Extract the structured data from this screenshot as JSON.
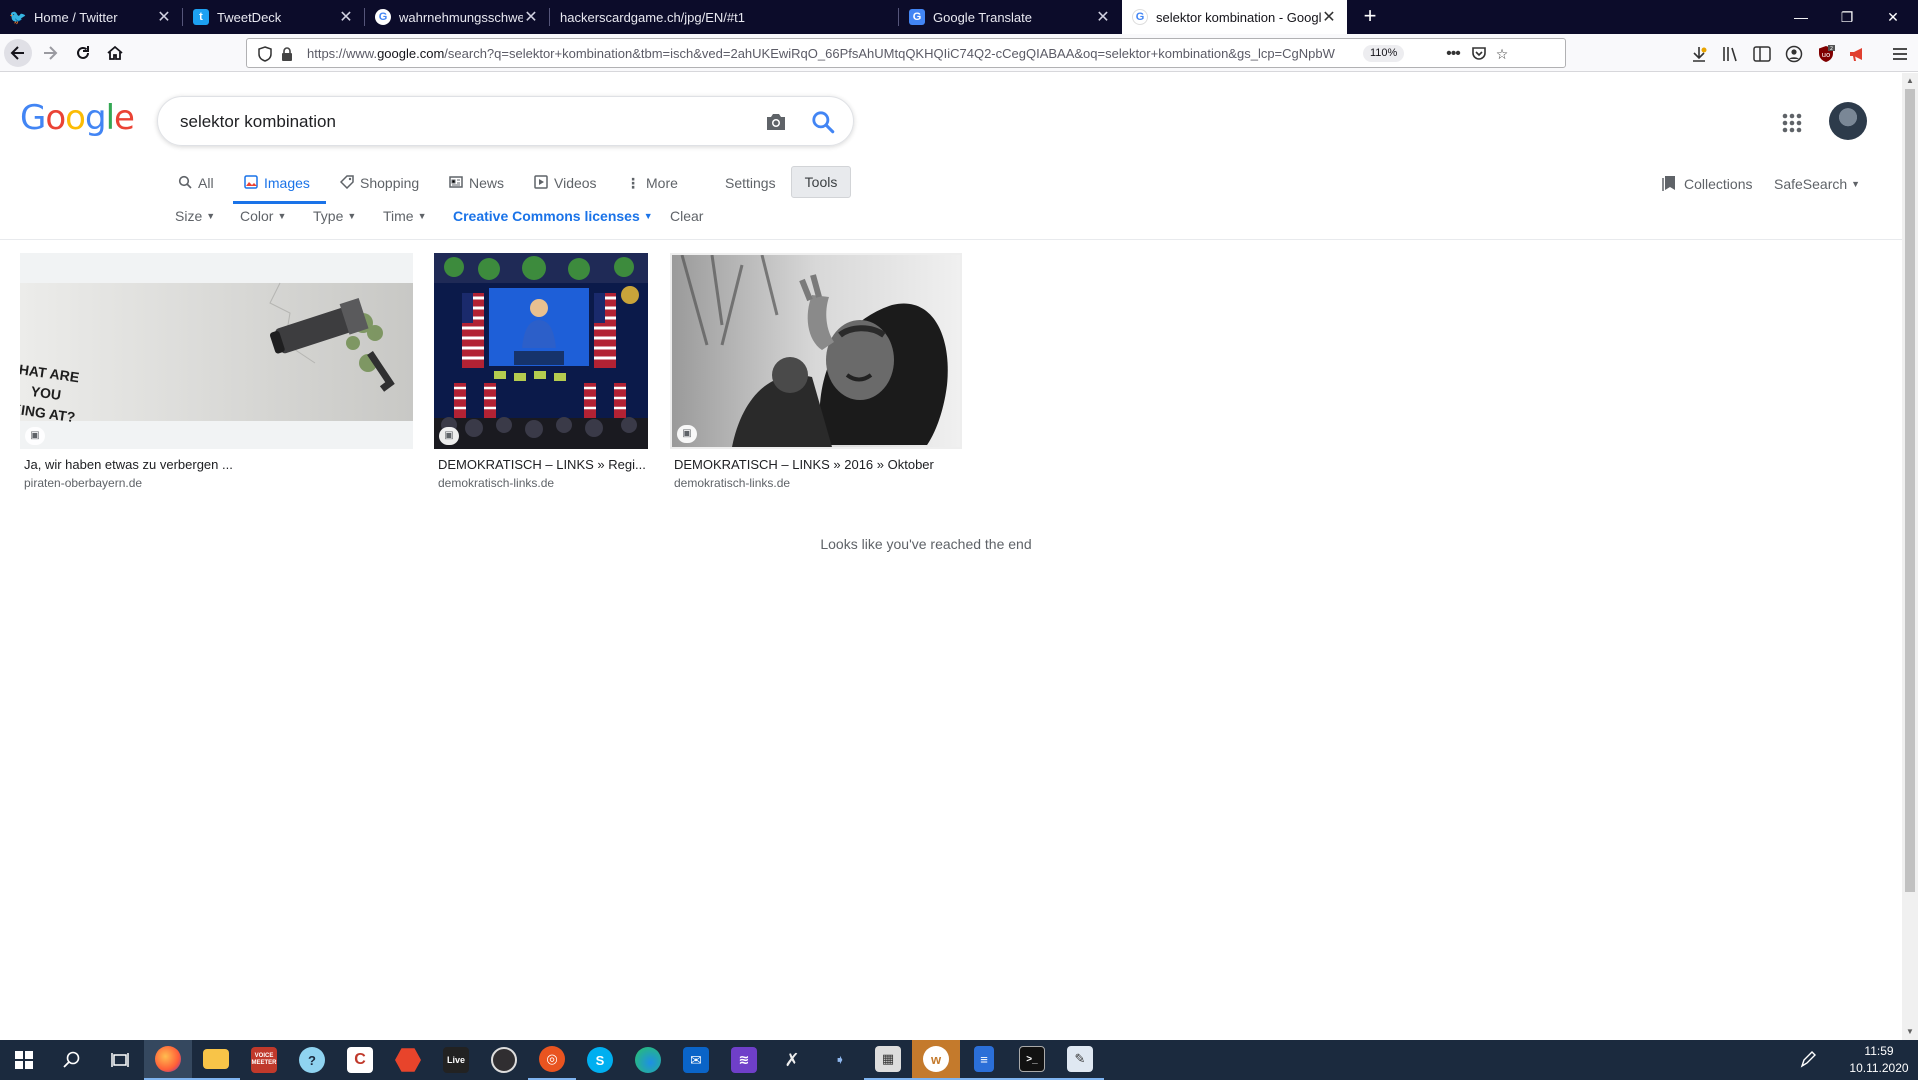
{
  "browser": {
    "tabs": [
      {
        "title": "Home / Twitter",
        "icon": "twitter-icon"
      },
      {
        "title": "TweetDeck",
        "icon": "tweetdeck-icon"
      },
      {
        "title": "wahrnehmungsschwelle - Goog",
        "icon": "google-icon"
      },
      {
        "title": "hackerscardgame.ch/jpg/EN/#t1",
        "icon": ""
      },
      {
        "title": "Google Translate",
        "icon": "google-translate-icon"
      },
      {
        "title": "selektor kombination - Google",
        "icon": "google-icon"
      }
    ],
    "url": {
      "prefix": "https://www.",
      "domain": "google.com",
      "rest": "/search?q=selektor+kombination&tbm=isch&ved=2ahUKEwiRqO_66PfsAhUMtqQKHQIiC74Q2-cCegQIABAA&oq=selektor+kombination&gs_lcp=CgNpbW"
    },
    "zoom": "110%"
  },
  "google": {
    "query": "selektor kombination",
    "nav": {
      "all": "All",
      "images": "Images",
      "shopping": "Shopping",
      "news": "News",
      "videos": "Videos",
      "more": "More",
      "settings": "Settings",
      "tools": "Tools",
      "collections": "Collections",
      "safesearch": "SafeSearch"
    },
    "filters": {
      "size": "Size",
      "color": "Color",
      "type": "Type",
      "time": "Time",
      "license": "Creative Commons licenses",
      "clear": "Clear"
    },
    "results": [
      {
        "title": "Ja, wir haben etwas zu verbergen ...",
        "site": "piraten-oberbayern.de",
        "image_text": "WHAT ARE\nYOU\nOKING AT?"
      },
      {
        "title": "DEMOKRATISCH – LINKS » Regi...",
        "site": "demokratisch-links.de"
      },
      {
        "title": "DEMOKRATISCH – LINKS » 2016 » Oktober",
        "site": "demokratisch-links.de"
      }
    ],
    "end_message": "Looks like you've reached the end"
  },
  "taskbar": {
    "time": "11:59",
    "date": "10.11.2020",
    "apps": [
      "firefox",
      "file-explorer",
      "voice-meeter",
      "app",
      "app",
      "app",
      "live",
      "obs",
      "ubuntu",
      "skype",
      "edge",
      "mail",
      "app",
      "app",
      "app",
      "app",
      "word",
      "docs",
      "terminal",
      "notepad"
    ],
    "voice_label": "VOICE\nMEETER",
    "live_label": "Live"
  },
  "colors": {
    "google_blue": "#4285F4",
    "google_red": "#EA4335",
    "google_yellow": "#FBBC05",
    "google_green": "#34A853",
    "accent": "#1a73e8"
  }
}
